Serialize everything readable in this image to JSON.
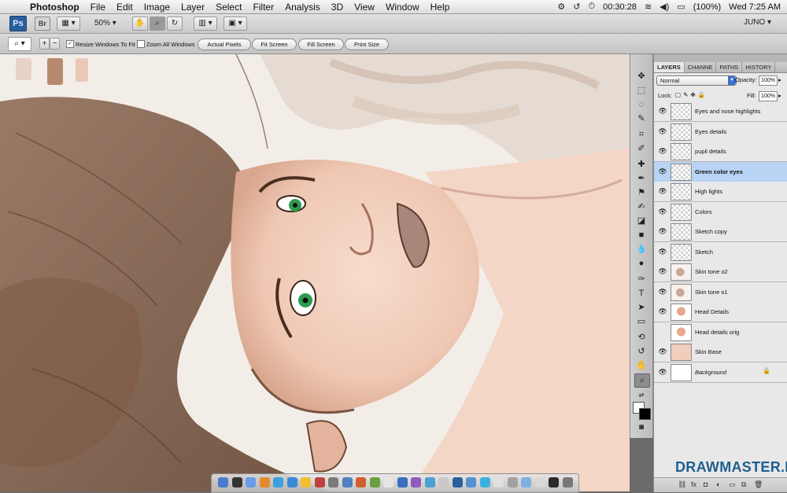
{
  "menubar": {
    "app_name": "Photoshop",
    "items": [
      "File",
      "Edit",
      "Image",
      "Layer",
      "Select",
      "Filter",
      "Analysis",
      "3D",
      "View",
      "Window",
      "Help"
    ],
    "timer": "00:30:28",
    "battery": "(100%)",
    "clock": "Wed 7:25 AM"
  },
  "appbar": {
    "ps_logo": "Ps",
    "br_logo": "Br",
    "zoom": "50%",
    "workspace": "JUNO"
  },
  "options": {
    "resize_windows": "Resize Windows To Fit",
    "resize_checked": "✓",
    "zoom_all": "Zoom All Windows",
    "actual_pixels": "Actual Pixels",
    "fit_screen": "Fit Screen",
    "fill_screen": "Fill Screen",
    "print_size": "Print Size"
  },
  "layers_panel": {
    "tabs": [
      "LAYERS",
      "CHANNE",
      "PATHS",
      "HISTORY"
    ],
    "blend_mode": "Normal",
    "opacity_label": "Opacity:",
    "opacity_value": "100%",
    "lock_label": "Lock:",
    "fill_label": "Fill:",
    "fill_value": "100%",
    "layers": [
      {
        "name": "Eyes and nose highlights",
        "thumb": "transparent",
        "visible": true
      },
      {
        "name": "Eyes details",
        "thumb": "transparent",
        "visible": true
      },
      {
        "name": "pupil details",
        "thumb": "transparent",
        "visible": true
      },
      {
        "name": "Green color eyes",
        "thumb": "transparent",
        "visible": true,
        "selected": true
      },
      {
        "name": "High lights",
        "thumb": "transparent",
        "visible": true
      },
      {
        "name": "Colors",
        "thumb": "transparent",
        "visible": true
      },
      {
        "name": "Sketch copy",
        "thumb": "transparent",
        "visible": true
      },
      {
        "name": "Sketch",
        "thumb": "transparent",
        "visible": true
      },
      {
        "name": "Skin tone o2",
        "thumb": "sketch",
        "visible": true
      },
      {
        "name": "Skin tone o1",
        "thumb": "sketch",
        "visible": true
      },
      {
        "name": "Head Details",
        "thumb": "face",
        "visible": true
      },
      {
        "name": "Head details orig",
        "thumb": "face",
        "visible": false
      },
      {
        "name": "Skin Base",
        "thumb": "skin",
        "visible": true
      },
      {
        "name": "Background",
        "thumb": "white",
        "visible": true,
        "italic": true,
        "locked": true
      }
    ]
  },
  "watermark": "DRAWMASTER.RU",
  "colors": {
    "selected_row": "#b8d3f3",
    "skin": "#f1cdbb",
    "hair": "#6e4a33"
  }
}
